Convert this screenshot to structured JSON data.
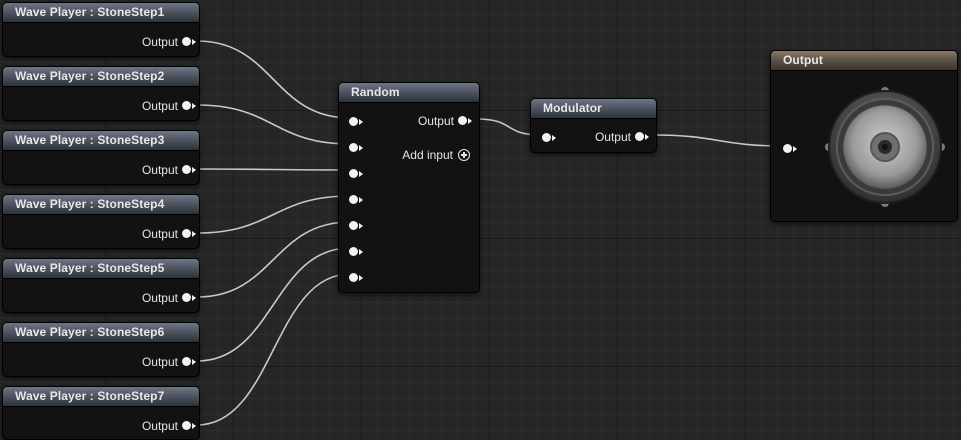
{
  "wave_players": [
    {
      "title": "Wave Player : StoneStep1",
      "output_label": "Output"
    },
    {
      "title": "Wave Player : StoneStep2",
      "output_label": "Output"
    },
    {
      "title": "Wave Player : StoneStep3",
      "output_label": "Output"
    },
    {
      "title": "Wave Player : StoneStep4",
      "output_label": "Output"
    },
    {
      "title": "Wave Player : StoneStep5",
      "output_label": "Output"
    },
    {
      "title": "Wave Player : StoneStep6",
      "output_label": "Output"
    },
    {
      "title": "Wave Player : StoneStep7",
      "output_label": "Output"
    }
  ],
  "random": {
    "title": "Random",
    "output_label": "Output",
    "add_input_label": "Add input",
    "input_count": 7
  },
  "modulator": {
    "title": "Modulator",
    "output_label": "Output"
  },
  "output": {
    "title": "Output",
    "icon": "speaker-icon"
  },
  "colors": {
    "wire": "#c8c8c8",
    "pin": "#f2f2f2",
    "header_blue": "#4f5663",
    "header_brown": "#5f5448"
  }
}
